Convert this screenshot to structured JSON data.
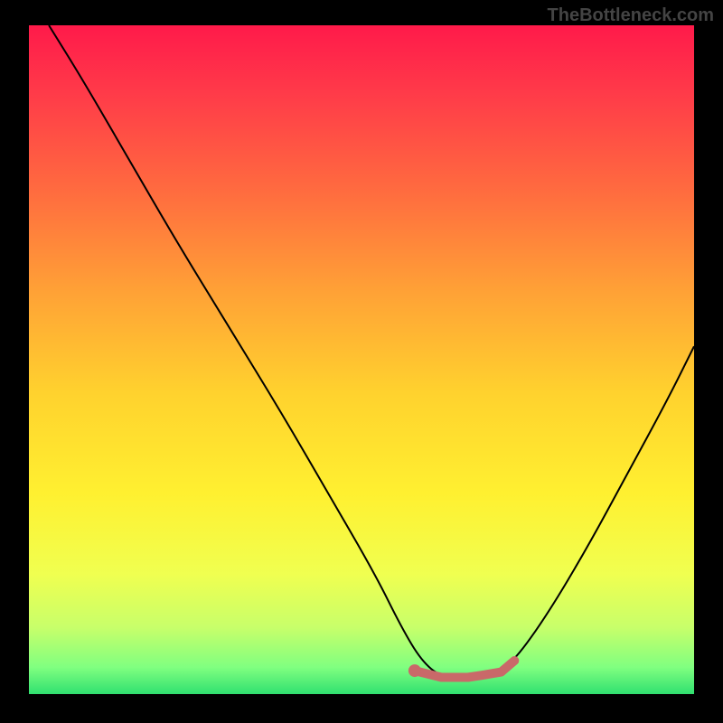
{
  "watermark": "TheBottleneck.com",
  "chart_data": {
    "type": "line",
    "title": "",
    "xlabel": "",
    "ylabel": "",
    "xlim": [
      0,
      100
    ],
    "ylim": [
      0,
      100
    ],
    "curve": {
      "x": [
        3,
        8,
        15,
        22,
        30,
        38,
        45,
        52,
        56,
        59,
        62,
        66,
        70,
        73,
        78,
        84,
        90,
        96,
        100
      ],
      "y": [
        100,
        92,
        80,
        68,
        55,
        42,
        30,
        18,
        10,
        5,
        2.5,
        2.5,
        3,
        5,
        12,
        22,
        33,
        44,
        52
      ]
    },
    "highlight_segment": {
      "x": [
        58,
        60,
        62,
        64,
        66,
        68,
        71,
        73
      ],
      "y": [
        3.5,
        3,
        2.5,
        2.5,
        2.5,
        2.8,
        3.3,
        5
      ],
      "color": "#c96969"
    },
    "highlight_start_dot": {
      "x": 58,
      "y": 3.5,
      "r": 5,
      "color": "#c96969"
    },
    "gradient_stops": [
      {
        "offset": 0.0,
        "color": "#ff1a4a"
      },
      {
        "offset": 0.1,
        "color": "#ff3a49"
      },
      {
        "offset": 0.25,
        "color": "#ff6c3f"
      },
      {
        "offset": 0.4,
        "color": "#ffa236"
      },
      {
        "offset": 0.55,
        "color": "#ffd22e"
      },
      {
        "offset": 0.7,
        "color": "#fff030"
      },
      {
        "offset": 0.82,
        "color": "#f0ff50"
      },
      {
        "offset": 0.9,
        "color": "#c8ff6a"
      },
      {
        "offset": 0.96,
        "color": "#80ff80"
      },
      {
        "offset": 1.0,
        "color": "#30e070"
      }
    ]
  }
}
